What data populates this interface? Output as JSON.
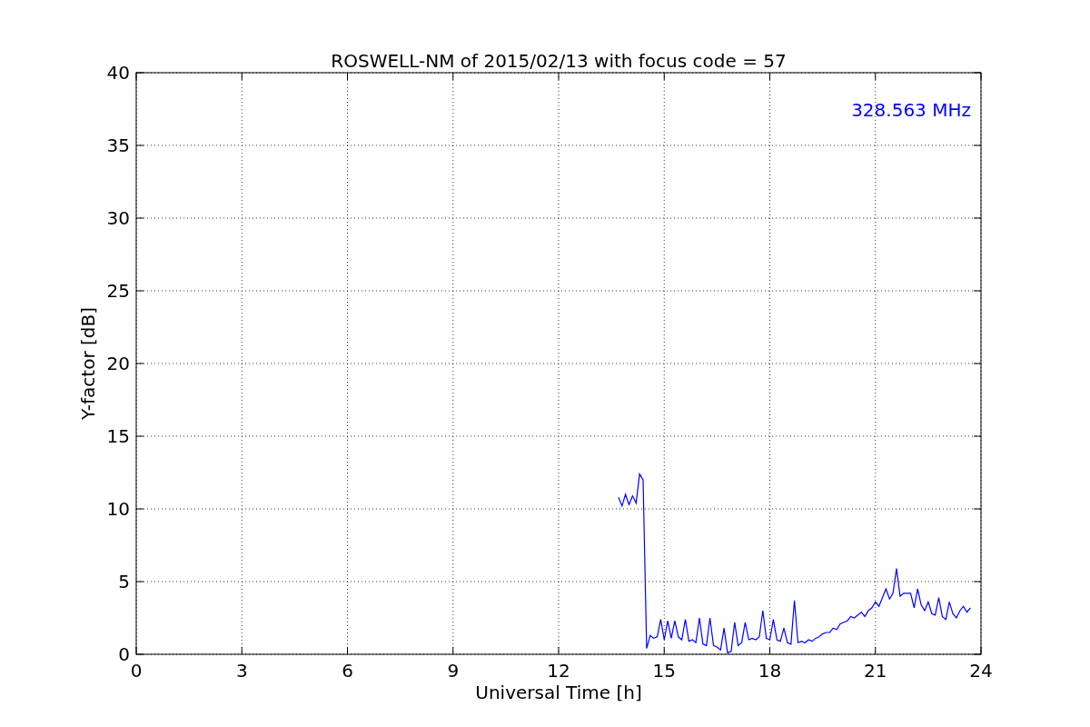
{
  "chart_data": {
    "type": "line",
    "title": "ROSWELL-NM of 2015/02/13 with focus code = 57",
    "xlabel": "Universal Time [h]",
    "ylabel": "Y-factor [dB]",
    "grid": true,
    "xlim": [
      0,
      24
    ],
    "ylim": [
      0,
      40
    ],
    "xticks": [
      0,
      3,
      6,
      9,
      12,
      15,
      18,
      21,
      24
    ],
    "yticks": [
      0,
      5,
      10,
      15,
      20,
      25,
      30,
      35,
      40
    ],
    "x": [
      13.7,
      13.8,
      13.9,
      14.0,
      14.1,
      14.2,
      14.3,
      14.4,
      14.5,
      14.6,
      14.7,
      14.8,
      14.9,
      15.0,
      15.1,
      15.2,
      15.3,
      15.4,
      15.5,
      15.6,
      15.7,
      15.8,
      15.9,
      16.0,
      16.1,
      16.2,
      16.3,
      16.4,
      16.5,
      16.6,
      16.7,
      16.8,
      16.9,
      17.0,
      17.1,
      17.2,
      17.3,
      17.4,
      17.5,
      17.6,
      17.7,
      17.8,
      17.9,
      18.0,
      18.1,
      18.2,
      18.3,
      18.4,
      18.5,
      18.6,
      18.7,
      18.8,
      18.9,
      19.0,
      19.1,
      19.2,
      19.3,
      19.4,
      19.5,
      19.6,
      19.7,
      19.8,
      19.9,
      20.0,
      20.1,
      20.2,
      20.3,
      20.4,
      20.5,
      20.6,
      20.7,
      20.8,
      20.9,
      21.0,
      21.1,
      21.2,
      21.3,
      21.4,
      21.5,
      21.6,
      21.7,
      21.8,
      21.9,
      22.0,
      22.1,
      22.2,
      22.3,
      22.4,
      22.5,
      22.6,
      22.7,
      22.8,
      22.9,
      23.0,
      23.1,
      23.2,
      23.3,
      23.4,
      23.5,
      23.6,
      23.7
    ],
    "series": [
      {
        "color": "#0000ff",
        "values": [
          10.8,
          10.2,
          11.0,
          10.3,
          10.9,
          10.4,
          12.4,
          12.0,
          0.4,
          1.3,
          1.1,
          1.2,
          2.4,
          1.0,
          2.3,
          1.1,
          2.3,
          1.2,
          1.0,
          2.4,
          0.9,
          1.0,
          0.8,
          2.5,
          0.7,
          0.6,
          2.5,
          0.6,
          0.5,
          0.3,
          1.8,
          0.1,
          0.2,
          2.2,
          0.6,
          0.8,
          2.2,
          1.0,
          1.1,
          1.0,
          1.2,
          3.0,
          1.1,
          1.0,
          2.4,
          1.0,
          0.9,
          1.8,
          0.8,
          0.7,
          3.7,
          0.8,
          0.9,
          0.8,
          1.0,
          0.9,
          1.1,
          1.2,
          1.4,
          1.5,
          1.5,
          1.8,
          1.7,
          2.1,
          2.2,
          2.3,
          2.6,
          2.5,
          2.7,
          2.9,
          2.6,
          3.0,
          3.2,
          3.6,
          3.3,
          3.9,
          4.5,
          3.8,
          4.2,
          5.9,
          4.0,
          4.2,
          4.2,
          4.2,
          3.2,
          4.5,
          3.4,
          3.0,
          3.6,
          2.8,
          2.7,
          3.9,
          2.6,
          2.4,
          3.6,
          2.8,
          2.5,
          3.0,
          3.3,
          2.9,
          3.2
        ]
      }
    ],
    "annotations": [
      {
        "text": "328.563 MHz"
      }
    ]
  }
}
